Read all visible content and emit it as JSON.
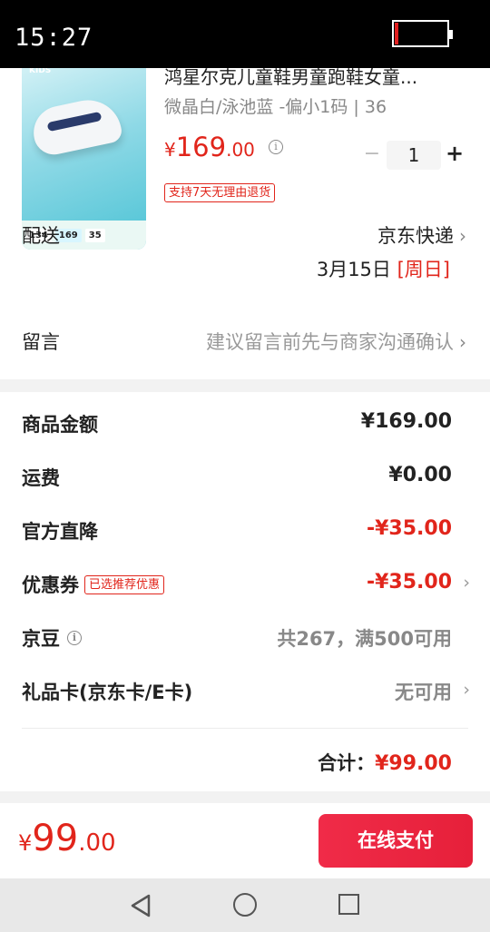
{
  "status_bar": {
    "time": "15:27"
  },
  "product": {
    "title": "鸿星尔克儿童鞋男童跑鞋女童...",
    "spec": "微晶白/泳池蓝 -偏小1码 | 36",
    "price_symbol": "¥",
    "price_int": "169",
    "price_dec": ".00",
    "quantity": "1",
    "minus": "−",
    "plus": "+",
    "return_tag": "支持7天无理由退货",
    "image_badges": [
      "134",
      "169",
      "35"
    ],
    "image_brand": "KIDS"
  },
  "delivery": {
    "label": "配送",
    "method": "京东快递",
    "date": "3月15日",
    "day": "[周日]"
  },
  "note": {
    "label": "留言",
    "hint": "建议留言前先与商家沟通确认"
  },
  "costs": {
    "goods_label": "商品金额",
    "goods_value": "¥169.00",
    "shipping_label": "运费",
    "shipping_value": "¥0.00",
    "discount_label": "官方直降",
    "discount_value": "-¥35.00",
    "coupon_label": "优惠券",
    "coupon_tag": "已选推荐优惠",
    "coupon_value": "-¥35.00",
    "jingdou_label": "京豆",
    "jingdou_value": "共267，满500可用",
    "giftcard_label": "礼品卡(京东卡/E卡)",
    "giftcard_value": "无可用",
    "total_label": "合计：",
    "total_value": "¥99.00"
  },
  "pay_bar": {
    "symbol": "¥",
    "int": "99",
    "dec": ".00",
    "button": "在线支付"
  },
  "colors": {
    "accent": "#e1251b",
    "button": "#ec2340"
  }
}
